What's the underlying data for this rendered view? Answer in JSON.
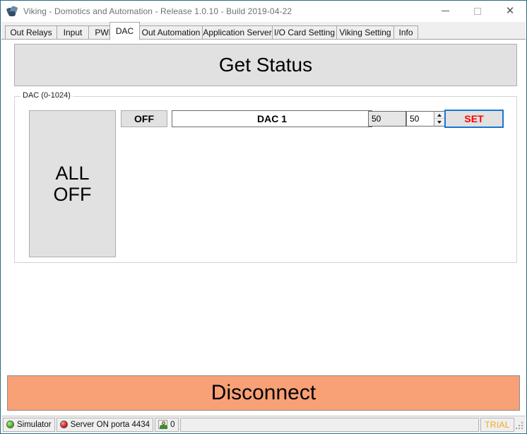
{
  "window": {
    "title": "Viking - Domotics and Automation - Release 1.0.10 - Build 2019-04-22",
    "icon": "viking-app-icon",
    "minimize_label": "—",
    "maximize_label": "",
    "close_label": "✕",
    "border_color": "#2b6a85"
  },
  "tabs": [
    {
      "label": "Out Relays",
      "selected": false
    },
    {
      "label": "Input",
      "selected": false
    },
    {
      "label": "PWM",
      "selected": false
    },
    {
      "label": "DAC",
      "selected": true
    },
    {
      "label": "Out Automation",
      "selected": false
    },
    {
      "label": "Application Server",
      "selected": false
    },
    {
      "label": "I/O Card Setting",
      "selected": false
    },
    {
      "label": "Viking Setting",
      "selected": false
    },
    {
      "label": "Info",
      "selected": false
    }
  ],
  "main": {
    "get_status_label": "Get Status",
    "group_label": "DAC (0-1024)",
    "all_off_line1": "ALL",
    "all_off_line2": "OFF",
    "channels": [
      {
        "state_label": "OFF",
        "name": "DAC 1",
        "readout_value": "50",
        "spinner_value": "50",
        "spin_up": "▲",
        "spin_down": "▼",
        "set_label": "SET",
        "set_text_color": "#ff0000",
        "set_border_color": "#1478d0"
      }
    ]
  },
  "footer": {
    "disconnect_label": "Disconnect",
    "disconnect_color": "#f8a076"
  },
  "statusbar": {
    "simulator_label": "Simulator",
    "simulator_led": "green",
    "server_label": "Server ON porta 4434",
    "server_led": "red",
    "users_count": "0",
    "users_icon": "user-icon",
    "message": "",
    "trial_label": "TRIAL",
    "trial_color": "#f2a81c"
  }
}
